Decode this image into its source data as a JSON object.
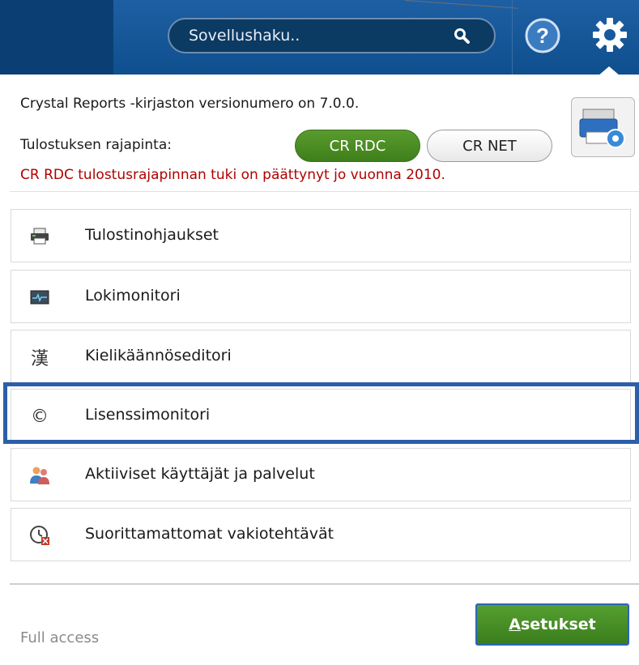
{
  "header": {
    "search_placeholder": "Sovellushaku..",
    "help_label": "?",
    "icons": [
      "search-icon",
      "help-icon",
      "gear-icon"
    ]
  },
  "info": {
    "version_text": "Crystal Reports -kirjaston versionumero on 7.0.0.",
    "interface_label": "Tulostuksen rajapinta:",
    "options": [
      "CR RDC",
      "CR NET"
    ],
    "selected_option": "CR RDC",
    "warning": "CR RDC tulostusrajapinnan tuki on päättynyt jo vuonna 2010."
  },
  "menu": {
    "items": [
      {
        "label": "Tulostinohjaukset",
        "icon": "printer-icon"
      },
      {
        "label": "Lokimonitori",
        "icon": "monitor-icon"
      },
      {
        "label": "Kielikäännöseditori",
        "icon": "kanji-icon",
        "glyph": "漢"
      },
      {
        "label": "Lisenssimonitori",
        "icon": "copyright-icon",
        "glyph": "©"
      },
      {
        "label": "Aktiiviset käyttäjät ja palvelut",
        "icon": "users-icon"
      },
      {
        "label": "Suorittamattomat vakiotehtävät",
        "icon": "clock-icon"
      }
    ],
    "highlighted_item": "Lisenssimonitori"
  },
  "footer": {
    "access_text": "Full access",
    "settings_label": "Asetukset"
  },
  "colors": {
    "header_blue": "#155a9e",
    "selected_green": "#3f7f1b",
    "warning_red": "#b00000",
    "highlight_blue": "#2b5fa8"
  }
}
